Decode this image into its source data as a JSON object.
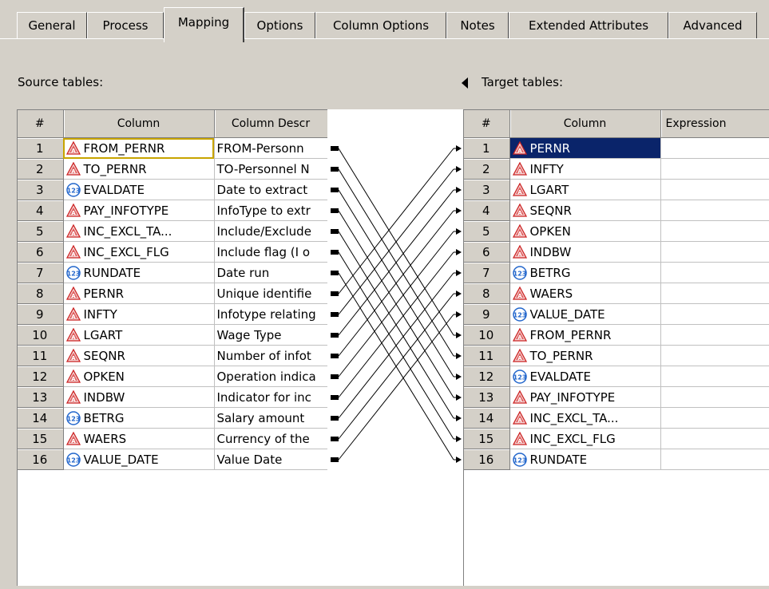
{
  "tabs": [
    "General",
    "Process",
    "Mapping",
    "Options",
    "Column Options",
    "Notes",
    "Extended Attributes",
    "Advanced"
  ],
  "active_tab": "Mapping",
  "source": {
    "label": "Source tables:",
    "headers": [
      "#",
      "Column",
      "Column Descr"
    ],
    "rows": [
      {
        "n": "1",
        "type": "char",
        "name": "FROM_PERNR",
        "desc": "FROM-Personn"
      },
      {
        "n": "2",
        "type": "char",
        "name": "TO_PERNR",
        "desc": "TO-Personnel N"
      },
      {
        "n": "3",
        "type": "num",
        "name": "EVALDATE",
        "desc": "Date to extract"
      },
      {
        "n": "4",
        "type": "char",
        "name": "PAY_INFOTYPE",
        "desc": "InfoType to extr"
      },
      {
        "n": "5",
        "type": "char",
        "name": "INC_EXCL_TA...",
        "desc": "Include/Exclude"
      },
      {
        "n": "6",
        "type": "char",
        "name": "INC_EXCL_FLG",
        "desc": "Include flag (I o"
      },
      {
        "n": "7",
        "type": "num",
        "name": "RUNDATE",
        "desc": "Date run"
      },
      {
        "n": "8",
        "type": "char",
        "name": "PERNR",
        "desc": "Unique identifie"
      },
      {
        "n": "9",
        "type": "char",
        "name": "INFTY",
        "desc": "Infotype relating"
      },
      {
        "n": "10",
        "type": "char",
        "name": "LGART",
        "desc": "Wage Type"
      },
      {
        "n": "11",
        "type": "char",
        "name": "SEQNR",
        "desc": "Number of infot"
      },
      {
        "n": "12",
        "type": "char",
        "name": "OPKEN",
        "desc": "Operation indica"
      },
      {
        "n": "13",
        "type": "char",
        "name": "INDBW",
        "desc": "Indicator for inc"
      },
      {
        "n": "14",
        "type": "num",
        "name": "BETRG",
        "desc": "Salary amount"
      },
      {
        "n": "15",
        "type": "char",
        "name": "WAERS",
        "desc": "Currency of the"
      },
      {
        "n": "16",
        "type": "num",
        "name": "VALUE_DATE",
        "desc": "Value Date"
      }
    ]
  },
  "target": {
    "label": "Target tables:",
    "headers": [
      "#",
      "Column",
      "Expression"
    ],
    "rows": [
      {
        "n": "1",
        "type": "char",
        "name": "PERNR"
      },
      {
        "n": "2",
        "type": "char",
        "name": "INFTY"
      },
      {
        "n": "3",
        "type": "char",
        "name": "LGART"
      },
      {
        "n": "4",
        "type": "char",
        "name": "SEQNR"
      },
      {
        "n": "5",
        "type": "char",
        "name": "OPKEN"
      },
      {
        "n": "6",
        "type": "char",
        "name": "INDBW"
      },
      {
        "n": "7",
        "type": "num",
        "name": "BETRG"
      },
      {
        "n": "8",
        "type": "char",
        "name": "WAERS"
      },
      {
        "n": "9",
        "type": "num",
        "name": "VALUE_DATE"
      },
      {
        "n": "10",
        "type": "char",
        "name": "FROM_PERNR"
      },
      {
        "n": "11",
        "type": "char",
        "name": "TO_PERNR"
      },
      {
        "n": "12",
        "type": "num",
        "name": "EVALDATE"
      },
      {
        "n": "13",
        "type": "char",
        "name": "PAY_INFOTYPE"
      },
      {
        "n": "14",
        "type": "char",
        "name": "INC_EXCL_TA..."
      },
      {
        "n": "15",
        "type": "char",
        "name": "INC_EXCL_FLG"
      },
      {
        "n": "16",
        "type": "num",
        "name": "RUNDATE"
      }
    ]
  },
  "mappings": [
    [
      1,
      10
    ],
    [
      2,
      11
    ],
    [
      3,
      12
    ],
    [
      4,
      13
    ],
    [
      5,
      14
    ],
    [
      6,
      15
    ],
    [
      7,
      16
    ],
    [
      8,
      1
    ],
    [
      9,
      2
    ],
    [
      10,
      3
    ],
    [
      11,
      4
    ],
    [
      12,
      5
    ],
    [
      13,
      6
    ],
    [
      14,
      7
    ],
    [
      15,
      8
    ],
    [
      16,
      9
    ]
  ],
  "icons": {
    "char": "character-column-icon",
    "num": "numeric-column-icon"
  },
  "colors": {
    "selection": "#0a246a",
    "focus": "#c8a400",
    "char_icon": "#cc2222",
    "num_icon": "#2266cc"
  }
}
